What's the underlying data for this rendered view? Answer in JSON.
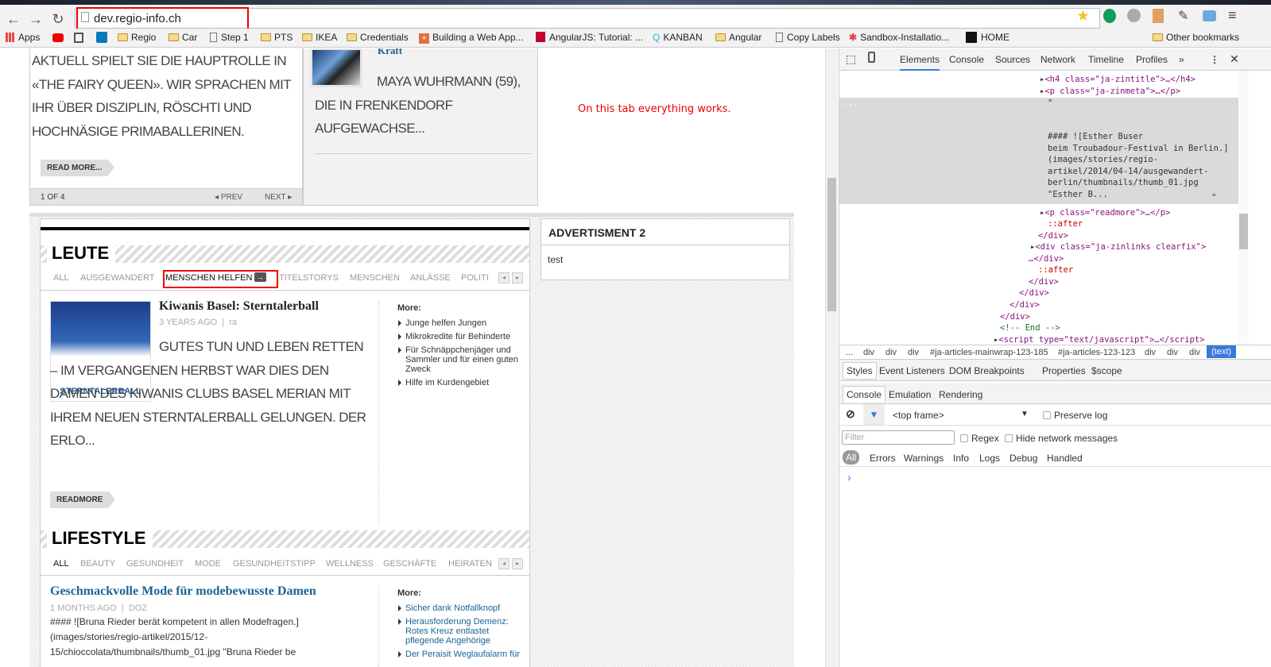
{
  "browser": {
    "url": "dev.regio-info.ch",
    "bookmarks": [
      "Apps",
      "Regio",
      "Car",
      "Step 1",
      "PTS",
      "IKEA",
      "Credentials",
      "Building a Web App...",
      "AngularJS: Tutorial: ...",
      "KANBAN",
      "Angular",
      "Copy Labels",
      "Sandbox-Installatio...",
      "HOME",
      "Other bookmarks"
    ]
  },
  "page": {
    "top_left_text": "AKTUELL SPIELT SIE DIE HAUPTROLLE IN «THE FAIRY QUEEN». WIR SPRACHEN MIT IHR ÜBER DISZIPLIN, RÖSCHTI UND HOCHNÄSIGE PRIMABALLERINEN.",
    "read_more": "READ MORE...",
    "pager": "1 OF 4",
    "prev": "PREV",
    "next": "NEXT",
    "right_item_title": "Kraft",
    "right_item_text": "MAYA WUHRMANN (59), DIE IN FRENKENDORF AUFGEWACHSE...",
    "note": "On this tab everything works.",
    "ad_title": "ADVERTISMENT 2",
    "ad_body": "test",
    "leute": {
      "title": "LEUTE",
      "tabs": [
        "ALL",
        "AUSGEWANDERT",
        "MENSCHEN HELFEN",
        "TITELSTORYS",
        "MENSCHEN",
        "ANLÄSSE",
        "POLITI"
      ],
      "article_title": "Kiwanis Basel: Sterntalerball",
      "meta_age": "3 YEARS AGO",
      "meta_author": "ra",
      "image_label": "STERNTALERBALL",
      "text": "GUTES TUN UND LEBEN RETTEN – IM VERGANGENEN HERBST WAR DIES DEN DAMEN DES KIWANIS CLUBS BASEL MERIAN MIT IHREM NEUEN STERNTALERBALL GELUNGEN. DER ERLO...",
      "readmore": "READMORE",
      "more_label": "More:",
      "more": [
        "Junge helfen Jungen",
        "Mikrokredite für Behinderte",
        "Für Schnäppchenjäger und Sammler und für einen guten Zweck",
        "Hilfe im Kurdengebiet"
      ]
    },
    "lifestyle": {
      "title": "LIFESTYLE",
      "tabs": [
        "ALL",
        "BEAUTY",
        "GESUNDHEIT",
        "MODE",
        "GESUNDHEITSTIPP",
        "WELLNESS",
        "GESCHÄFTE",
        "HEIRATEN"
      ],
      "article_title": "Geschmackvolle Mode für modebewusste Damen",
      "meta_age": "1 MONTHS AGO",
      "meta_author": "DOZ",
      "text": "#### ![Bruna Rieder berät kompetent in allen Modefragen.] (images/stories/regio-artikel/2015/12-15/chioccolata/thumbnails/thumb_01.jpg \"Bruna Rieder be",
      "more_label": "More:",
      "more": [
        "Sicher dank Notfallknopf",
        "Herausforderung Demenz: Rotes Kreuz entlastet pflegende Angehörige",
        "Der Peraisit Weglaufalarm für"
      ]
    }
  },
  "devtools": {
    "tabs": [
      "Elements",
      "Console",
      "Sources",
      "Network",
      "Timeline",
      "Profiles"
    ],
    "dom": {
      "h4": "<h4 class=\"ja-zintitle\">…</h4>",
      "p_meta": "<p class=\"ja-zinmeta\">…</p>",
      "quote_open": "\"",
      "text_node": "#### ![Esther Buser\nbeim Troubadour-Festival in Berlin.]\n(images/stories/regio-\nartikel/2014/04-14/ausgewandert-\nberlin/thumbnails/thumb_01.jpg\n\"Esther B...",
      "quote_close": "\"",
      "readmore": "<p class=\"readmore\">…</p>",
      "after1": "::after",
      "close1": "</div>",
      "zinlinks": "<div class=\"ja-zinlinks clearfix\">",
      "zinlinks_close": "…</div>",
      "after2": "::after",
      "close2": "</div>",
      "close3": "</div>",
      "close4": "</div>",
      "close5": "</div>",
      "comment": "<!-- End -->",
      "script": "<script type=\"text/javascript\">…</script>"
    },
    "breadcrumbs": [
      "...",
      "div",
      "div",
      "div",
      "#ja-articles-mainwrap-123-185",
      "#ja-articles-123-123",
      "div",
      "div",
      "div",
      "(text)"
    ],
    "sidebar_tabs": [
      "Styles",
      "Event Listeners",
      "DOM Breakpoints",
      "Properties",
      "$scope"
    ],
    "drawer_tabs": [
      "Console",
      "Emulation",
      "Rendering"
    ],
    "frame": "<top frame>",
    "preserve_log": "Preserve log",
    "filter_placeholder": "Filter",
    "regex": "Regex",
    "hide_network": "Hide network messages",
    "levels": [
      "All",
      "Errors",
      "Warnings",
      "Info",
      "Logs",
      "Debug",
      "Handled"
    ],
    "prompt": "›"
  },
  "colors": {
    "highlight": "#e00000",
    "link": "#1a6496",
    "devtools_accent": "#3879d9"
  }
}
